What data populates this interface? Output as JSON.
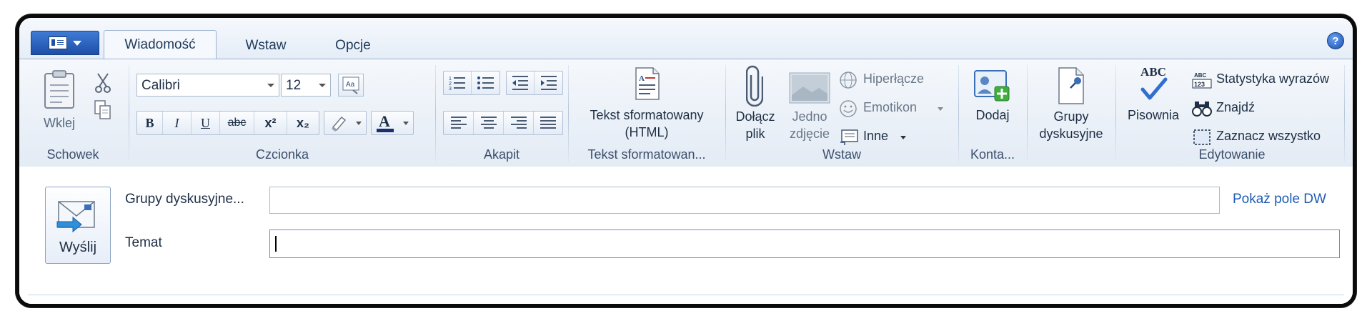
{
  "tabs": {
    "home": "Wiadomość",
    "insert": "Wstaw",
    "options": "Opcje"
  },
  "ribbon": {
    "clipboard": {
      "group_label": "Schowek",
      "paste": "Wklej"
    },
    "font": {
      "group_label": "Czcionka",
      "font_name": "Calibri",
      "font_size": "12",
      "bold": "B",
      "italic": "I",
      "underline": "U",
      "strike": "abc",
      "superscript": "x²",
      "subscript": "x₂",
      "font_color_letter": "A"
    },
    "paragraph": {
      "group_label": "Akapit"
    },
    "rich_text": {
      "group_label": "Tekst sformatowan...",
      "button_line1": "Tekst sformatowany",
      "button_line2": "(HTML)"
    },
    "insert": {
      "group_label": "Wstaw",
      "attach_line1": "Dołącz",
      "attach_line2": "plik",
      "photo_line1": "Jedno",
      "photo_line2": "zdjęcie",
      "hyperlink": "Hiperłącze",
      "emoticon": "Emotikon",
      "other": "Inne"
    },
    "contacts": {
      "group_label": "Konta...",
      "add": "Dodaj"
    },
    "newsgroups": {
      "line1": "Grupy",
      "line2": "dyskusyjne"
    },
    "editing": {
      "group_label": "Edytowanie",
      "spelling": "Pisownia",
      "abc": "ABC",
      "word_count": "Statystyka wyrazów",
      "find": "Znajdź",
      "select_all": "Zaznacz wszystko"
    }
  },
  "compose": {
    "send": "Wyślij",
    "newsgroups_label": "Grupy dyskusyjne...",
    "newsgroups_value": "",
    "subject_label": "Temat",
    "subject_value": "",
    "show_cc": "Pokaż pole DW"
  },
  "colors": {
    "accent": "#1d4fa8",
    "link": "#1f5bb3",
    "ribbon_bg": "#e3ebf5"
  }
}
